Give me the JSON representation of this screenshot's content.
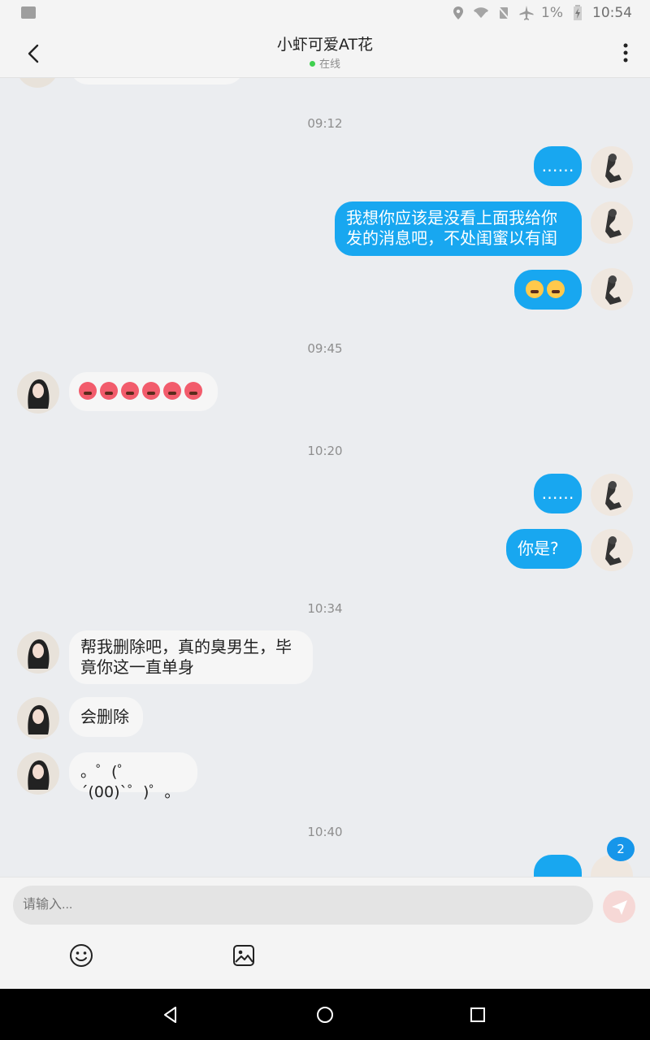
{
  "status_bar": {
    "battery": "1%",
    "time": "10:54",
    "icons": [
      "image-icon",
      "location-icon",
      "wifi-icon",
      "no-sim-icon",
      "airplane-icon",
      "battery-icon"
    ]
  },
  "header": {
    "title": "小虾可爱AT花",
    "status": "在线",
    "status_color": "#3fd04f"
  },
  "messages": {
    "ts1": "09:12",
    "m1": "……",
    "m2": "我想你应该是没看上面我给你发的消息吧，不处闺蜜以有闺",
    "m3_emoji": [
      "laugh-emoji",
      "laugh-emoji"
    ],
    "ts2": "09:45",
    "m4_emoji": [
      "angry-emoji",
      "angry-emoji",
      "angry-emoji",
      "angry-emoji",
      "angry-emoji",
      "angry-emoji"
    ],
    "ts3": "10:20",
    "m5": "……",
    "m6": "你是?",
    "ts4": "10:34",
    "m7": "帮我删除吧，真的臭男生，毕竟你这一直单身",
    "m8": "会删除",
    "m9": "。゜(゜´(00)`゜)゜。",
    "ts5": "10:40",
    "unread_badge": "2"
  },
  "composer": {
    "placeholder": "请输入..."
  },
  "colors": {
    "outgoing_bubble": "#18a7f0",
    "incoming_bubble": "#f6f6f6",
    "badge": "#1696ea"
  }
}
